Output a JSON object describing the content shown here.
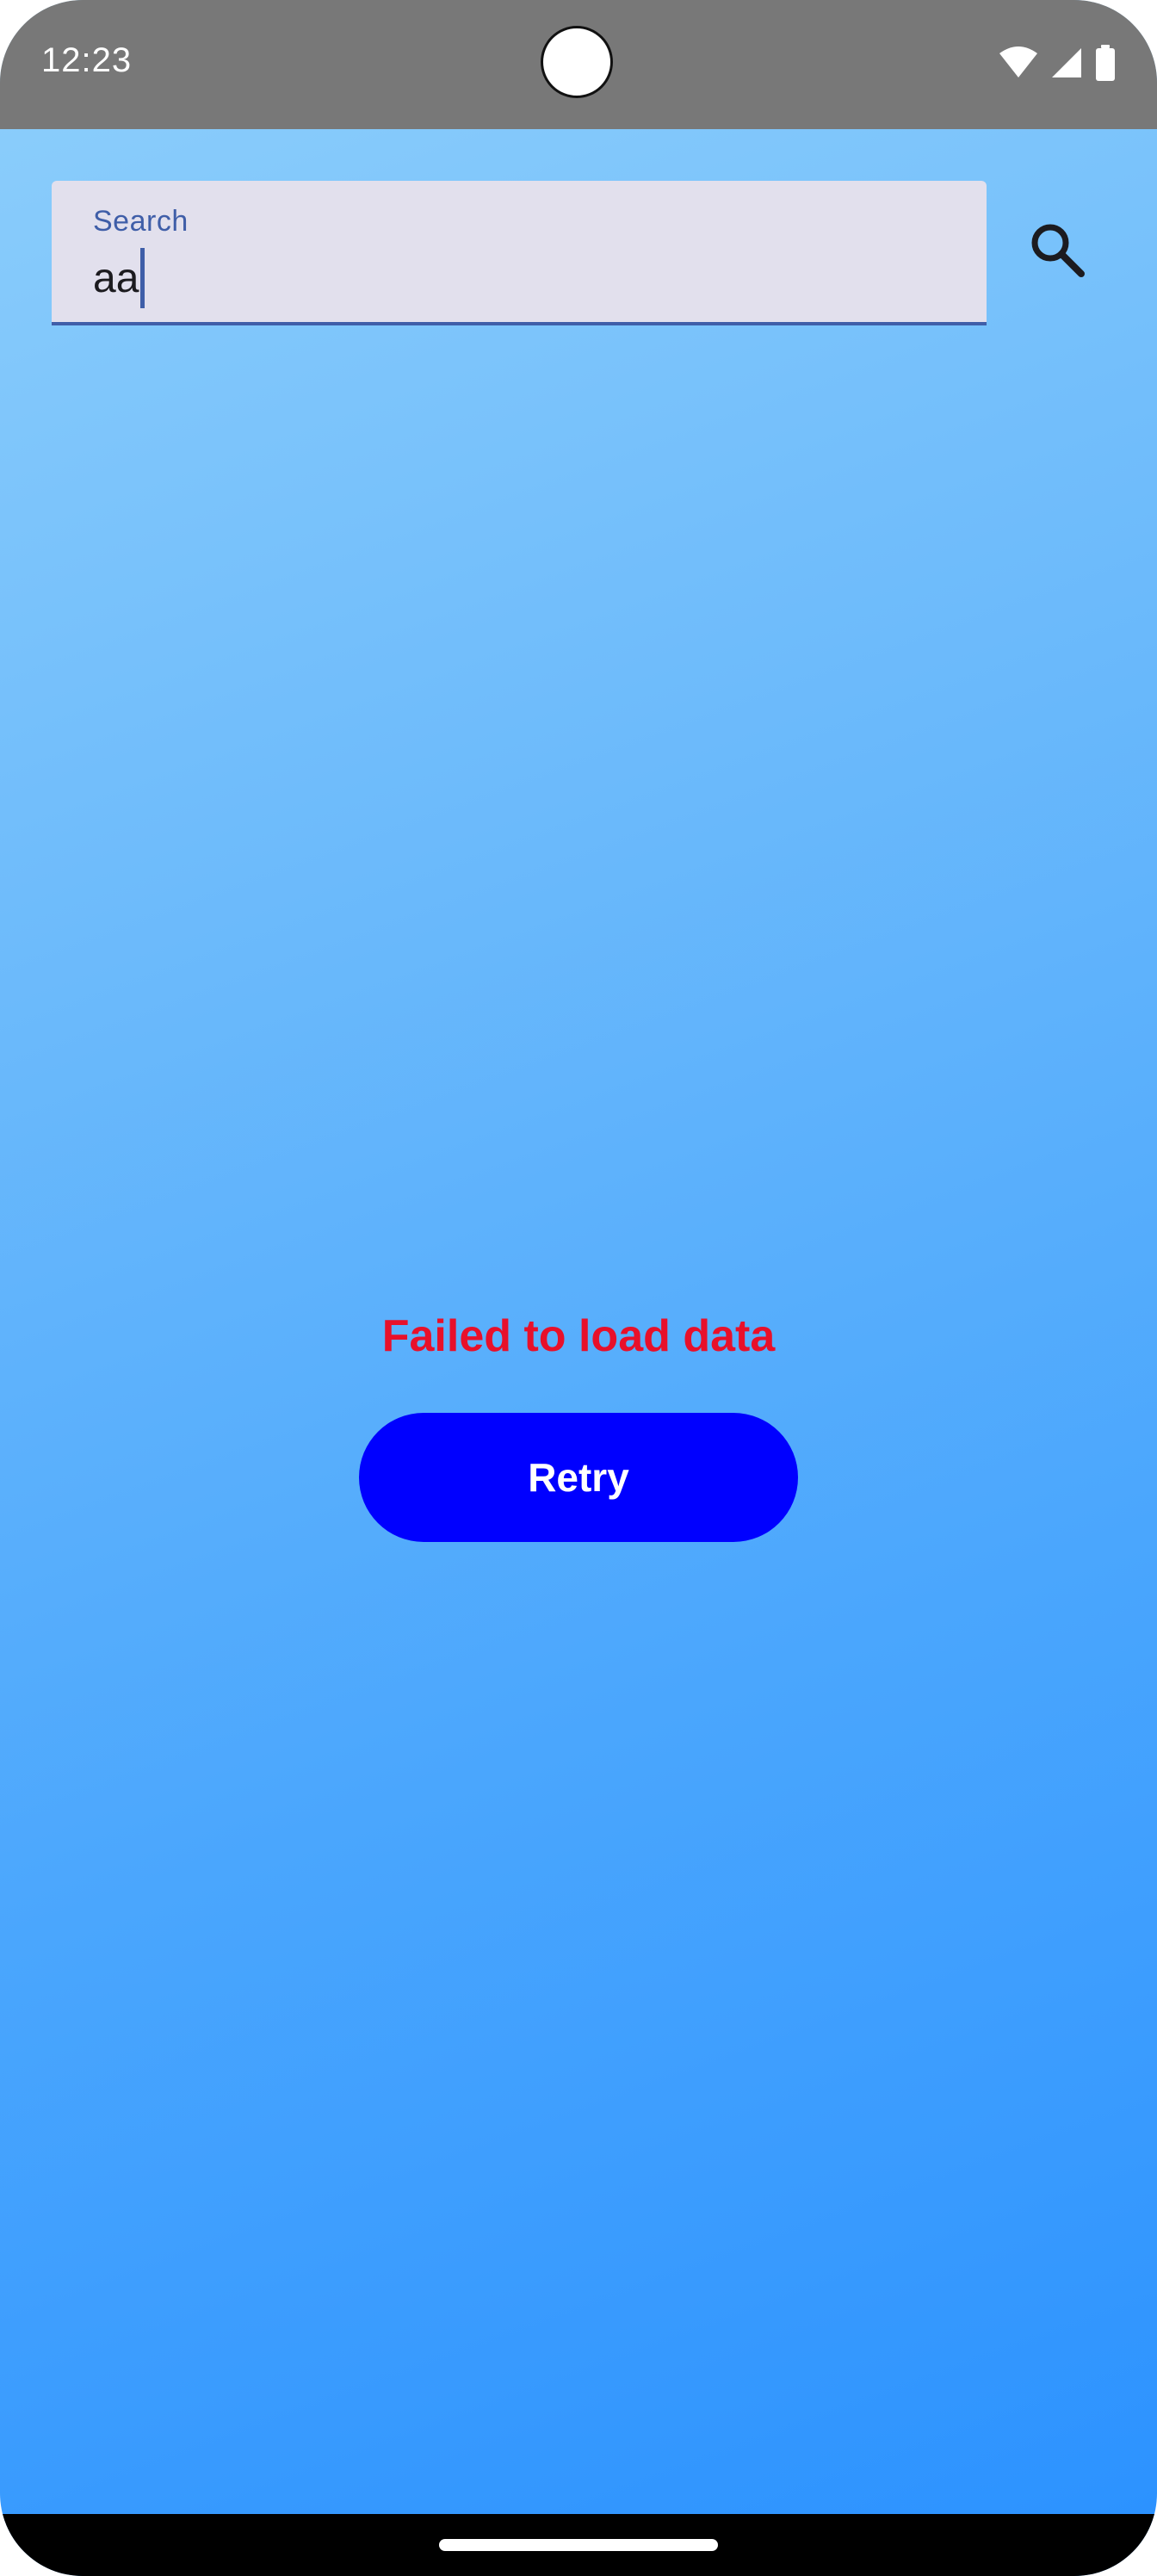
{
  "status_bar": {
    "time": "12:23",
    "icons": [
      "wifi-icon",
      "cellular-signal-icon",
      "battery-icon"
    ]
  },
  "search": {
    "label": "Search",
    "value": "aa",
    "button_icon": "search-icon"
  },
  "error": {
    "message": "Failed to load data"
  },
  "retry": {
    "label": "Retry"
  },
  "colors": {
    "background_top": "#8ecffb",
    "background_bottom": "#2a91ff",
    "status_bar": "#787878",
    "search_field_bg": "#e2e0ed",
    "search_accent": "#3f5ea8",
    "error_text": "#e8102a",
    "retry_button": "#0000ff"
  }
}
